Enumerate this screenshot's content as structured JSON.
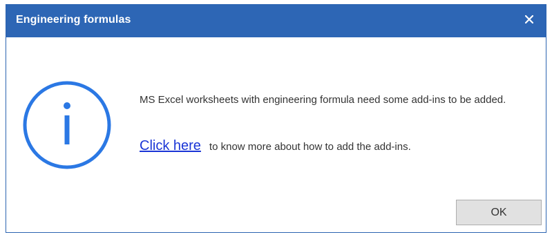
{
  "dialog": {
    "title": "Engineering formulas",
    "close_icon": "close-icon",
    "icon": "info-icon",
    "message": "MS Excel worksheets with engineering formula need some add-ins to be added.",
    "link_text": "Click here",
    "link_suffix": "to know more about how to add the add-ins.",
    "ok_label": "OK"
  },
  "colors": {
    "titlebar": "#2d66b5",
    "icon": "#2b78e4",
    "link": "#1a35d6",
    "button_bg": "#e1e1e1"
  }
}
